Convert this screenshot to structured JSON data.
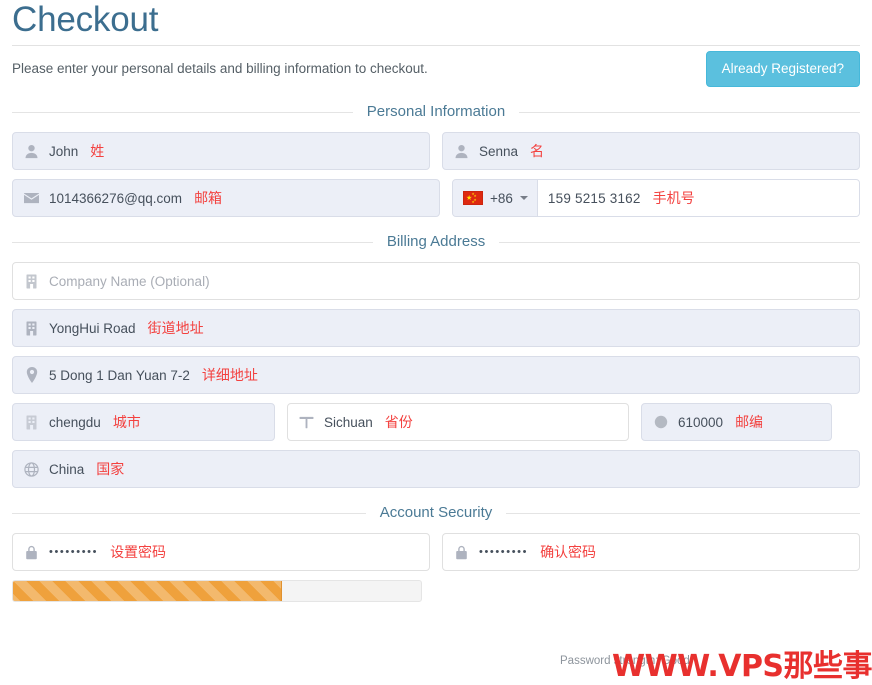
{
  "header": {
    "title": "Checkout",
    "intro": "Please enter your personal details and billing information to checkout.",
    "registered_button": "Already Registered?"
  },
  "sections": {
    "personal": "Personal Information",
    "billing": "Billing Address",
    "security": "Account Security"
  },
  "personal": {
    "first_name": {
      "icon": "user-icon",
      "value": "John",
      "annotation": "姓"
    },
    "last_name": {
      "icon": "user-icon",
      "value": "Senna",
      "annotation": "名"
    },
    "email": {
      "icon": "envelope-icon",
      "value": "1014366276@qq.com",
      "annotation": "邮箱"
    },
    "phone": {
      "icon": "flag-cn-icon",
      "dial_code": "+86",
      "value": "159 5215 3162",
      "annotation": "手机号"
    }
  },
  "billing": {
    "company": {
      "icon": "building-icon",
      "placeholder": "Company Name (Optional)",
      "value": ""
    },
    "street": {
      "icon": "building-icon",
      "value": "YongHui Road",
      "annotation": "街道地址"
    },
    "address2": {
      "icon": "map-pin-icon",
      "value": "5 Dong 1 Dan Yuan 7-2",
      "annotation": "详细地址"
    },
    "city": {
      "icon": "city-icon",
      "value": "chengdu",
      "annotation": "城市"
    },
    "state": {
      "icon": "map-icon",
      "value": "Sichuan",
      "annotation": "省份"
    },
    "zip": {
      "icon": "circle-icon",
      "value": "610000",
      "annotation": "邮编"
    },
    "country": {
      "icon": "globe-icon",
      "value": "China",
      "annotation": "国家"
    }
  },
  "security": {
    "password": {
      "icon": "lock-icon",
      "value": "•••••••••",
      "annotation": "设置密码"
    },
    "confirm_password": {
      "icon": "lock-icon",
      "value": "•••••••••",
      "annotation": "确认密码"
    },
    "strength_label": "Password strength: Good",
    "strength_percent": 66
  },
  "watermark": "WWW.VPS那些事",
  "colors": {
    "title": "#3c6e8f",
    "section_label": "#4b7a95",
    "annotation": "#f3413f",
    "button": "#5bc0de",
    "field_bg": "#eceff7",
    "meter_fill": "#efa13c",
    "watermark": "#e8302e"
  }
}
